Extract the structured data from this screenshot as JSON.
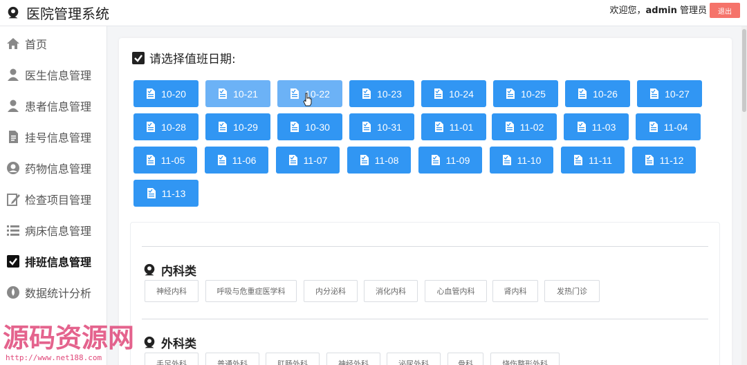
{
  "header": {
    "app_title": "医院管理系统",
    "welcome_prefix": "欢迎您，",
    "username": "admin",
    "role": "管理员",
    "logout_label": "退出"
  },
  "sidebar": {
    "items": [
      {
        "label": "首页",
        "icon": "home-icon"
      },
      {
        "label": "医生信息管理",
        "icon": "user-icon"
      },
      {
        "label": "患者信息管理",
        "icon": "user-icon"
      },
      {
        "label": "挂号信息管理",
        "icon": "document-icon"
      },
      {
        "label": "药物信息管理",
        "icon": "face-icon"
      },
      {
        "label": "检查项目管理",
        "icon": "edit-icon"
      },
      {
        "label": "病床信息管理",
        "icon": "list-icon"
      },
      {
        "label": "排班信息管理",
        "icon": "checkbox-icon",
        "active": true
      },
      {
        "label": "数据统计分析",
        "icon": "drop-icon"
      }
    ]
  },
  "schedule": {
    "prompt": "请选择值班日期:",
    "dates": [
      "10-20",
      "10-21",
      "10-22",
      "10-23",
      "10-24",
      "10-25",
      "10-26",
      "10-27",
      "10-28",
      "10-29",
      "10-30",
      "10-31",
      "11-01",
      "11-02",
      "11-03",
      "11-04",
      "11-05",
      "11-06",
      "11-07",
      "11-08",
      "11-09",
      "11-10",
      "11-11",
      "11-12",
      "11-13"
    ]
  },
  "categories": [
    {
      "title": "内科类",
      "depts": [
        "神经内科",
        "呼吸与危重症医学科",
        "内分泌科",
        "消化内科",
        "心血管内科",
        "肾内科",
        "发热门诊"
      ]
    },
    {
      "title": "外科类",
      "depts": [
        "手足外科",
        "普通外科",
        "肛肠外科",
        "神经外科",
        "泌尿外科",
        "骨科",
        "烧伤整形外科"
      ]
    }
  ],
  "watermark": {
    "text": "源码资源网",
    "url": "http://www.net188.com"
  },
  "colors": {
    "primary": "#3196f3",
    "primary_hover": "#6cb2f6",
    "danger": "#f5736a"
  }
}
